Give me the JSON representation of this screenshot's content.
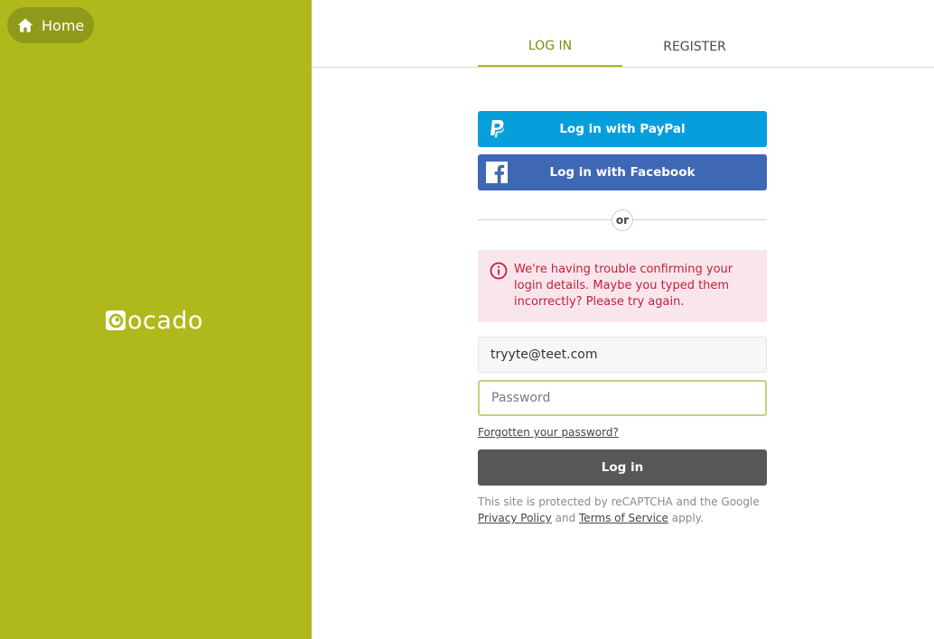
{
  "nav": {
    "home_label": "Home"
  },
  "brand": {
    "name": "ocado"
  },
  "tabs": [
    {
      "label": "LOG IN",
      "active": true
    },
    {
      "label": "REGISTER",
      "active": false
    }
  ],
  "social": {
    "paypal_label": "Log in with PayPal",
    "facebook_label": "Log in with Facebook"
  },
  "divider": {
    "label": "or"
  },
  "error": {
    "message": "We're having trouble confirming your login details. Maybe you typed them incorrectly? Please try again."
  },
  "form": {
    "email_value": "tryyte@teet.com",
    "password_placeholder": "Password",
    "forgot_label": "Forgotten your password?",
    "login_label": "Log in"
  },
  "recaptcha": {
    "text_before": "This site is protected by reCAPTCHA and the Google",
    "privacy_label": "Privacy Policy",
    "and_text": "and",
    "terms_label": "Terms of Service",
    "apply_text": "apply."
  },
  "colors": {
    "brand_green": "#afb91c",
    "paypal_blue": "#069fdc",
    "facebook_blue": "#3f68b4",
    "error_red": "#c4203c",
    "error_bg": "#f9e6ec",
    "login_button": "#555759"
  },
  "icons": [
    "home-icon",
    "ocado-logo-icon",
    "paypal-icon",
    "facebook-icon",
    "alert-circle-icon"
  ]
}
